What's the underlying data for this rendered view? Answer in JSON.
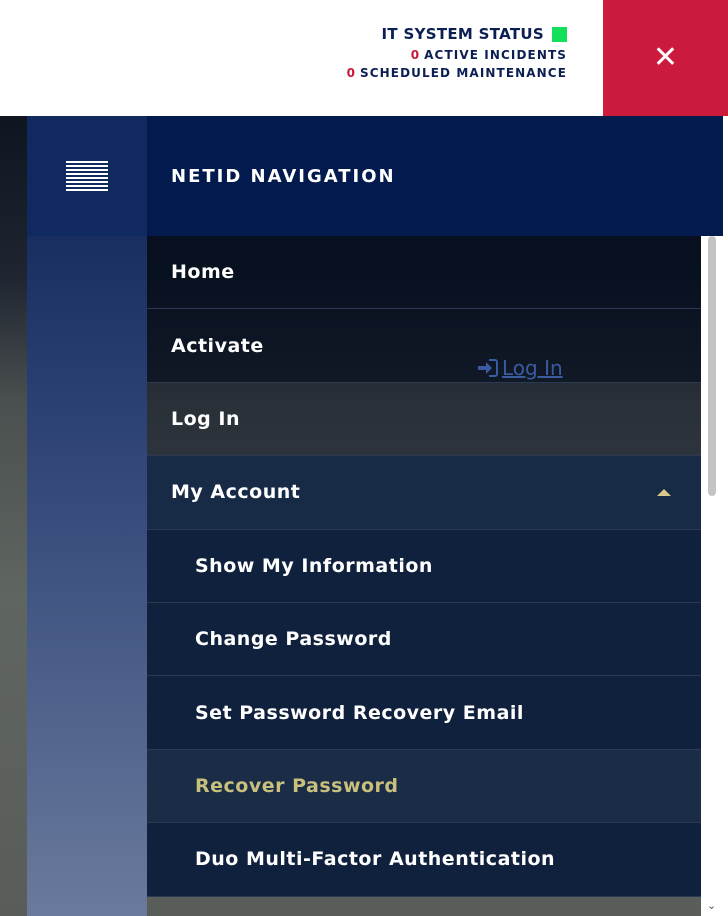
{
  "status": {
    "title": "IT SYSTEM STATUS",
    "indicator_color": "#12e05a",
    "incident_count": "0",
    "incident_label": "ACTIVE INCIDENTS",
    "maintenance_count": "0",
    "maintenance_label": "SCHEDULED MAINTENANCE",
    "count_color": "#c8163c"
  },
  "close": {
    "icon": "close-icon",
    "glyph": "✕",
    "bg_color": "#cc1a3d"
  },
  "menu": {
    "icon": "hamburger-menu-icon"
  },
  "nav": {
    "title": "NETID NAVIGATION",
    "items": [
      {
        "label": "Home"
      },
      {
        "label": "Activate"
      },
      {
        "label": "Log In"
      },
      {
        "label": "My Account",
        "expanded": true,
        "icon": "chevron-up-icon"
      }
    ],
    "subitems": [
      {
        "label": "Show My Information"
      },
      {
        "label": "Change Password"
      },
      {
        "label": "Set Password Recovery Email"
      },
      {
        "label": "Recover Password",
        "active": true
      },
      {
        "label": "Duo Multi-Factor Authentication"
      }
    ],
    "active_color": "#c8c07c"
  },
  "background_page": {
    "login_link": "Log In",
    "login_icon": "sign-in-icon"
  }
}
